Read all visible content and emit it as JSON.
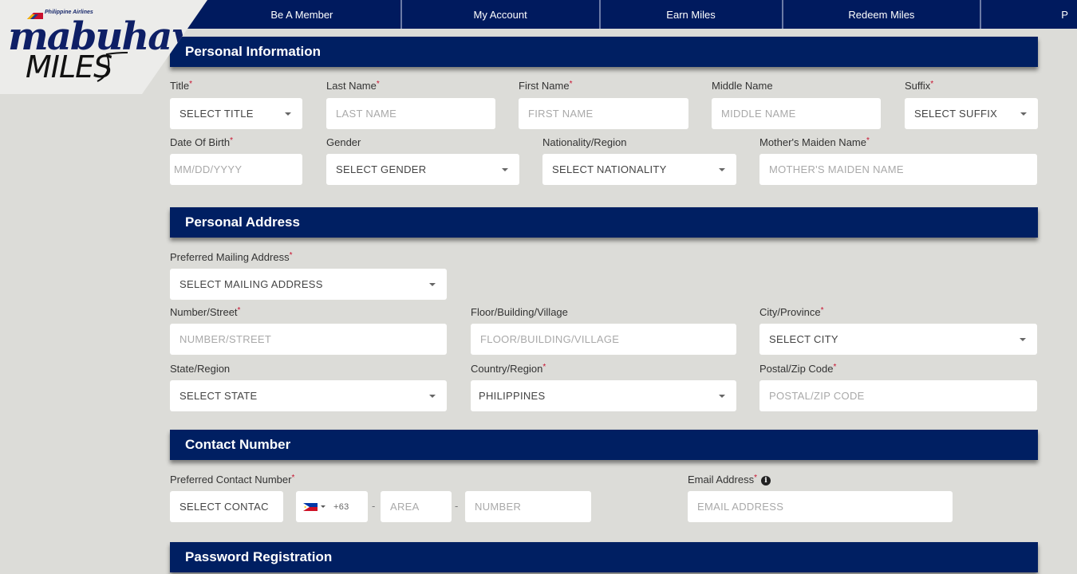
{
  "brand": {
    "airline": "Philippine Airlines",
    "script": "mabuhay",
    "miles": "MILES"
  },
  "nav": {
    "items": [
      "Be A Member",
      "My Account",
      "Earn Miles",
      "Redeem Miles",
      "P"
    ]
  },
  "colors": {
    "navy": "#001f62",
    "required": "#c8102e",
    "background": "#dcdcd8"
  },
  "sections": {
    "personal_information": {
      "title": "Personal Information",
      "title_field": {
        "label": "Title",
        "value": "SELECT TITLE"
      },
      "last_name": {
        "label": "Last Name",
        "placeholder": "LAST NAME"
      },
      "first_name": {
        "label": "First Name",
        "placeholder": "FIRST NAME"
      },
      "middle_name": {
        "label": "Middle Name",
        "placeholder": "MIDDLE NAME"
      },
      "suffix": {
        "label": "Suffix",
        "value": "SELECT SUFFIX"
      },
      "dob": {
        "label": "Date Of Birth",
        "placeholder": "MM/DD/YYYY"
      },
      "gender": {
        "label": "Gender",
        "value": "SELECT GENDER"
      },
      "nationality": {
        "label": "Nationality/Region",
        "value": "SELECT NATIONALITY"
      },
      "maiden_name": {
        "label": "Mother's Maiden Name",
        "placeholder": "MOTHER'S MAIDEN NAME"
      }
    },
    "personal_address": {
      "title": "Personal Address",
      "mailing": {
        "label": "Preferred Mailing Address",
        "value": "SELECT MAILING ADDRESS"
      },
      "street": {
        "label": "Number/Street",
        "placeholder": "NUMBER/STREET"
      },
      "building": {
        "label": "Floor/Building/Village",
        "placeholder": "FLOOR/BUILDING/VILLAGE"
      },
      "city": {
        "label": "City/Province",
        "value": "SELECT CITY"
      },
      "state": {
        "label": "State/Region",
        "value": "SELECT STATE"
      },
      "country": {
        "label": "Country/Region",
        "value": "PHILIPPINES"
      },
      "postal": {
        "label": "Postal/Zip Code",
        "placeholder": "POSTAL/ZIP CODE"
      }
    },
    "contact_number": {
      "title": "Contact Number",
      "preferred": {
        "label": "Preferred Contact Number",
        "value": "SELECT CONTAC"
      },
      "country_code": "+63",
      "area": {
        "placeholder": "AREA"
      },
      "number": {
        "placeholder": "NUMBER"
      },
      "separator": "-",
      "email": {
        "label": "Email Address",
        "placeholder": "EMAIL ADDRESS",
        "info_glyph": "i"
      }
    },
    "password_registration": {
      "title": "Password Registration"
    }
  },
  "required_mark": "*"
}
